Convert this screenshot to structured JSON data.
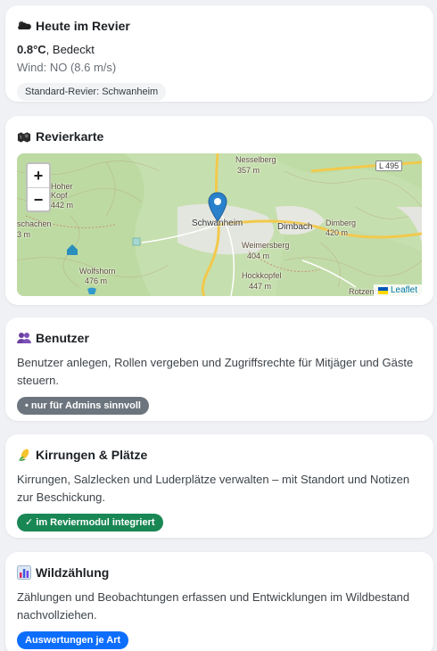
{
  "weather": {
    "title": "Heute im Revier",
    "temperature": "0.8°C",
    "condition": ", Bedeckt",
    "wind": "Wind: NO (8.6 m/s)",
    "badge": "Standard-Revier: Schwanheim"
  },
  "map_card": {
    "title": "Revierkarte",
    "zoom_in": "+",
    "zoom_out": "−",
    "attribution": "Leaflet",
    "labels": {
      "nesselberg": "Nesselberg",
      "nesselberg_h": "357 m",
      "road": "L 495",
      "hoher": "Hoher",
      "kopf": "Kopf",
      "kopf_h": "442 m",
      "schwanheim": "Schwanheim",
      "dimbach": "Dimbach",
      "dimberg": "Dimberg",
      "dimberg_h": "420 m",
      "schachen": "schachen",
      "schachen_h": "3 m",
      "weimersberg": "Weimersberg",
      "weimersberg_h": "404 m",
      "wolfshorn": "Wolfshorn",
      "wolfshorn_h": "476 m",
      "hockkopf": "Hockkopfel",
      "hockkopf_h": "447 m",
      "rotzenberg": "Rotzenbe"
    }
  },
  "users": {
    "title": "Benutzer",
    "text": "Benutzer anlegen, Rollen vergeben und Zugriffsrechte für Mitjäger und Gäste steuern.",
    "badge": "• nur für Admins sinnvoll"
  },
  "feeding": {
    "title": "Kirrungen & Plätze",
    "text": "Kirrungen, Salzlecken und Luderplätze verwalten – mit Standort und Notizen zur Beschickung.",
    "badge": "✓ im Reviermodul integriert"
  },
  "census": {
    "title": "Wildzählung",
    "text": "Zählungen und Beobachtungen erfassen und Entwicklungen im Wildbestand nachvollziehen.",
    "badge": "Auswertungen je Art"
  }
}
